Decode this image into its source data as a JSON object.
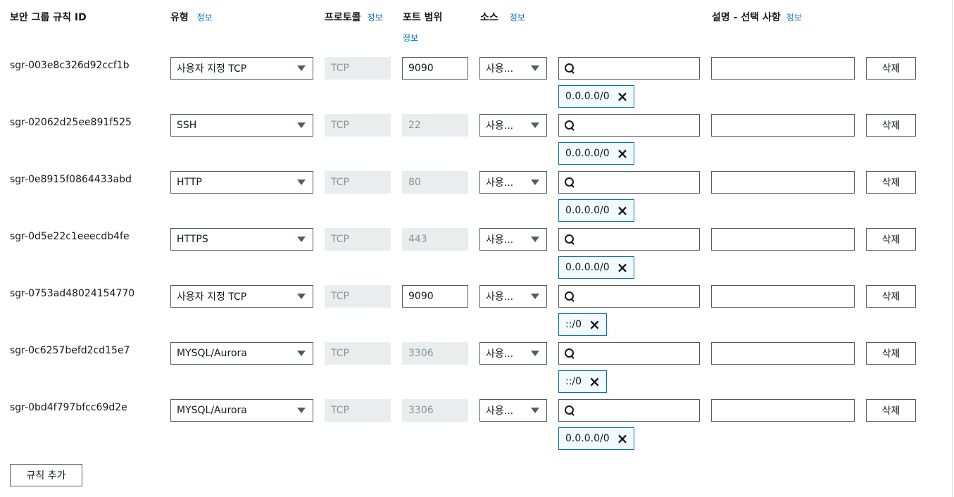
{
  "headers": {
    "rule_id": "보안 그룹 규칙 ID",
    "type": "유형",
    "protocol": "프로토콜",
    "port_range": "포트 범위",
    "source": "소스",
    "description": "설명 - 선택 사항",
    "info": "정보"
  },
  "rules": [
    {
      "id": "sgr-003e8c326d92ccf1b",
      "type": "사용자 지정 TCP",
      "protocol": "TCP",
      "port": "9090",
      "port_editable": true,
      "source": "사용...",
      "cidr": "0.0.0.0/0"
    },
    {
      "id": "sgr-02062d25ee891f525",
      "type": "SSH",
      "protocol": "TCP",
      "port": "22",
      "port_editable": false,
      "source": "사용...",
      "cidr": "0.0.0.0/0"
    },
    {
      "id": "sgr-0e8915f0864433abd",
      "type": "HTTP",
      "protocol": "TCP",
      "port": "80",
      "port_editable": false,
      "source": "사용...",
      "cidr": "0.0.0.0/0"
    },
    {
      "id": "sgr-0d5e22c1eeecdb4fe",
      "type": "HTTPS",
      "protocol": "TCP",
      "port": "443",
      "port_editable": false,
      "source": "사용...",
      "cidr": "0.0.0.0/0"
    },
    {
      "id": "sgr-0753ad48024154770",
      "type": "사용자 지정 TCP",
      "protocol": "TCP",
      "port": "9090",
      "port_editable": true,
      "source": "사용...",
      "cidr": "::/0"
    },
    {
      "id": "sgr-0c6257befd2cd15e7",
      "type": "MYSQL/Aurora",
      "protocol": "TCP",
      "port": "3306",
      "port_editable": false,
      "source": "사용...",
      "cidr": "::/0"
    },
    {
      "id": "sgr-0bd4f797bfcc69d2e",
      "type": "MYSQL/Aurora",
      "protocol": "TCP",
      "port": "3306",
      "port_editable": false,
      "source": "사용...",
      "cidr": "0.0.0.0/0"
    }
  ],
  "delete_label": "삭제",
  "add_rule_label": "규칙 추가",
  "icons": {
    "search": "search-icon",
    "dropdown": "caret-down-icon",
    "remove": "close-icon"
  },
  "colors": {
    "link": "#0073bb",
    "token_border": "#0073bb",
    "token_bg": "#f1faff",
    "disabled_bg": "#eaeded"
  }
}
